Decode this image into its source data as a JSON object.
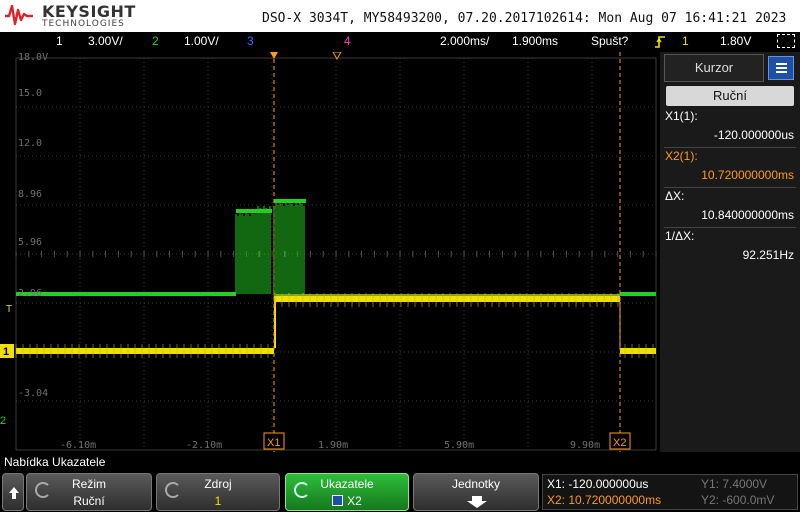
{
  "header": {
    "brand": "KEYSIGHT",
    "brand_sub": "TECHNOLOGIES",
    "title": "DSO-X 3034T, MY58493200, 07.20.2017102614: Mon Aug 07 16:41:21 2023"
  },
  "status": {
    "ch1_label": "1",
    "ch1_scale": "3.00V/",
    "ch2_label": "2",
    "ch2_scale": "1.00V/",
    "ch3_label": "3",
    "ch4_label": "4",
    "timebase": "2.000ms/",
    "delay": "1.900ms",
    "trigger_mode": "Spušt?",
    "trigger_source": "1",
    "trigger_level": "1.80V"
  },
  "plot": {
    "y_labels": [
      "18.0V",
      "15.0",
      "12.0",
      "8.96",
      "5.96",
      "2.96",
      "-3.04"
    ],
    "x_labels": [
      "-6.10m",
      "-2.10m",
      "1.90m",
      "5.90m",
      "9.90m"
    ],
    "cursor_x1_label": "X1",
    "cursor_x2_label": "X2",
    "ch1_marker": "1",
    "ch2_marker": "2",
    "trig_marker": "T",
    "colors": {
      "ch1": "#f0e000",
      "ch2": "#22d022",
      "cursor": "#ff9a1a",
      "grid": "#3a3a3a"
    }
  },
  "panel": {
    "tab_label": "Kurzor",
    "mode": "Ruční",
    "x1_label": "X1(1):",
    "x1_value": "-120.000000us",
    "x2_label": "X2(1):",
    "x2_value": "10.720000000ms",
    "dx_label": "ΔX:",
    "dx_value": "10.840000000ms",
    "inv_dx_label": "1/ΔX:",
    "inv_dx_value": "92.251Hz"
  },
  "menu": {
    "title": "Nabídka Ukazatele",
    "mode_title": "Režim",
    "mode_value": "Ruční",
    "source_title": "Zdroj",
    "source_value": "1",
    "cursors_title": "Ukazatele",
    "cursors_value": "X2",
    "units_title": "Jednotky"
  },
  "readout": {
    "x1": "X1:  -120.000000us",
    "x2": "X2:  10.720000000ms",
    "y1": "Y1: 7.4000V",
    "y2": "Y2: -600.0mV"
  }
}
